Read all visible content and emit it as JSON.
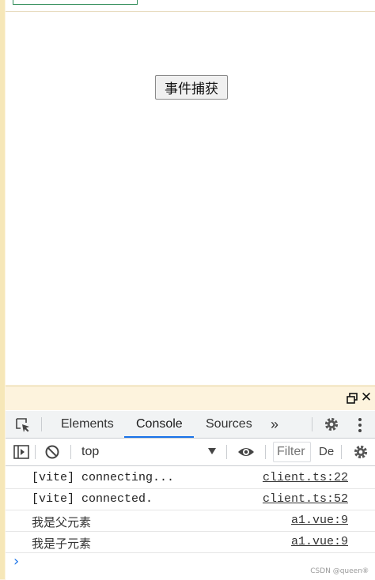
{
  "page": {
    "capture_button_label": "事件捕获"
  },
  "devtools": {
    "tabs": [
      "Elements",
      "Console",
      "Sources"
    ],
    "active_tab": "Console",
    "more_tabs_glyph": "»",
    "context": "top",
    "filter_placeholder": "Filter",
    "levels_label": "De",
    "logs": [
      {
        "message": "[vite] connecting...",
        "source": "client.ts:22"
      },
      {
        "message": "[vite] connected.",
        "source": "client.ts:52"
      },
      {
        "message": "我是父元素",
        "source": "a1.vue:9"
      },
      {
        "message": "我是子元素",
        "source": "a1.vue:9"
      }
    ],
    "prompt_glyph": "›",
    "close_glyph": "✕"
  },
  "watermark": "CSDN @queen⑧",
  "colors": {
    "accent": "#1a73e8",
    "background_strip": "#fdf3dd"
  }
}
